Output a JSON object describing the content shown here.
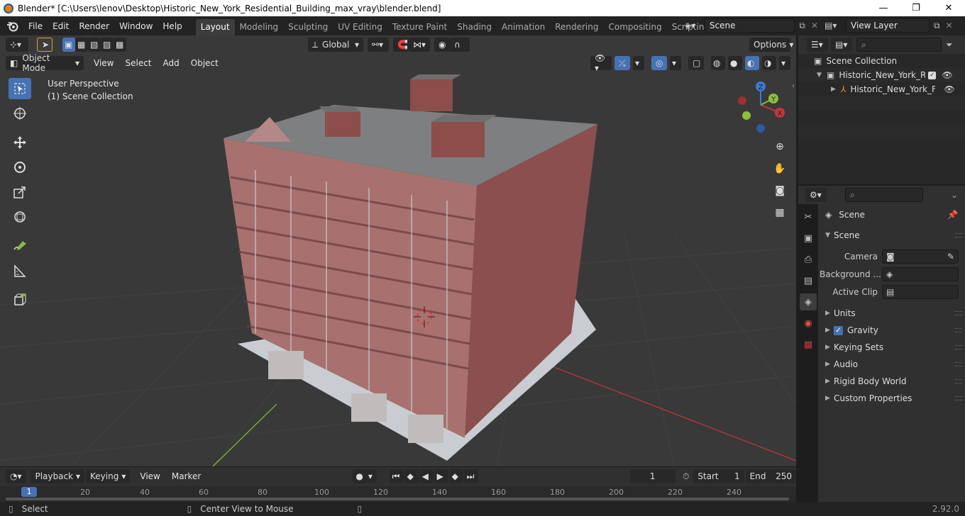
{
  "window": {
    "title": "Blender* [C:\\Users\\lenov\\Desktop\\Historic_New_York_Residential_Building_max_vray\\blender.blend]",
    "minimize": "—",
    "maximize": "❐",
    "close": "✕"
  },
  "menu": [
    "File",
    "Edit",
    "Render",
    "Window",
    "Help"
  ],
  "workspaces": [
    "Layout",
    "Modeling",
    "Sculpting",
    "UV Editing",
    "Texture Paint",
    "Shading",
    "Animation",
    "Rendering",
    "Compositing",
    "Scripting"
  ],
  "active_workspace": "Layout",
  "scene_name": "Scene",
  "view_layer": "View Layer",
  "viewport": {
    "transform_orientation": "Global",
    "options_label": "Options",
    "mode": "Object Mode",
    "header_menus": [
      "View",
      "Select",
      "Add",
      "Object"
    ],
    "perspective_label": "User Perspective",
    "collection_label": "(1) Scene Collection",
    "gizmo_axes": [
      "X",
      "Y",
      "Z"
    ]
  },
  "timeline": {
    "menus": [
      "Playback",
      "Keying",
      "View",
      "Marker"
    ],
    "current_frame": "1",
    "start_label": "Start",
    "start_value": "1",
    "end_label": "End",
    "end_value": "250",
    "ruler": [
      "1",
      "20",
      "40",
      "60",
      "80",
      "100",
      "120",
      "140",
      "160",
      "180",
      "200",
      "220",
      "240"
    ]
  },
  "status": {
    "select": "Select",
    "center_view": "Center View to Mouse",
    "version": "2.92.0"
  },
  "outliner": {
    "root": "Scene Collection",
    "collection": "Historic_New_York_Resic",
    "object": "Historic_New_York_F"
  },
  "properties": {
    "context": "Scene",
    "panel_scene": "Scene",
    "camera_label": "Camera",
    "background_label": "Background ...",
    "active_clip_label": "Active Clip",
    "panels": [
      "Units",
      "Gravity",
      "Keying Sets",
      "Audio",
      "Rigid Body World",
      "Custom Properties"
    ],
    "gravity_checked": true
  },
  "colors": {
    "accent": "#4772b3",
    "x_axis": "#c6373a",
    "y_axis": "#8bbf3a",
    "z_axis": "#3b7bd9",
    "brick": "#9a5a57"
  }
}
